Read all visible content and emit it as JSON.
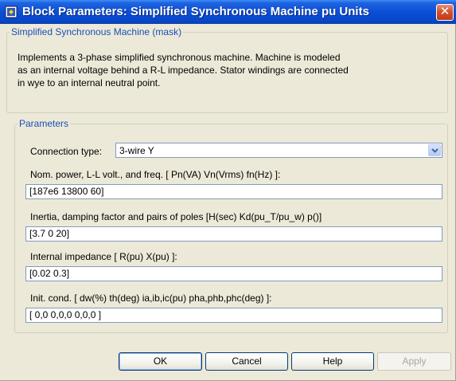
{
  "window": {
    "title": "Block Parameters: Simplified Synchronous Machine pu Units",
    "close_glyph": "✕"
  },
  "mask": {
    "legend": "Simplified Synchronous Machine (mask)",
    "description_lines": [
      "Implements a 3-phase simplified synchronous machine. Machine is modeled",
      "as an internal voltage behind a R-L impedance. Stator windings are connected",
      "in wye to an internal neutral point."
    ]
  },
  "parameters": {
    "legend": "Parameters",
    "connection_type": {
      "label": "Connection type:",
      "value": "3-wire Y"
    },
    "nominal": {
      "label": "Nom. power, L-L volt., and freq. [ Pn(VA) Vn(Vrms) fn(Hz) ]:",
      "value": "[187e6 13800 60]"
    },
    "inertia": {
      "label": "Inertia, damping factor and pairs of poles [H(sec) Kd(pu_T/pu_w) p()]",
      "value": "[3.7 0 20]"
    },
    "impedance": {
      "label": "Internal impedance [ R(pu) X(pu) ]:",
      "value": "[0.02  0.3]"
    },
    "init_cond": {
      "label": "Init. cond. [ dw(%)  th(deg)  ia,ib,ic(pu)  pha,phb,phc(deg) ]:",
      "value": "[ 0,0  0,0,0  0,0,0 ]"
    }
  },
  "buttons": {
    "ok": "OK",
    "cancel": "Cancel",
    "help": "Help",
    "apply": "Apply"
  },
  "icons": {
    "app": "simulink-block-icon",
    "close": "close-icon",
    "dropdown": "chevron-down-icon"
  },
  "colors": {
    "titlebar": "#0a4fd6",
    "dialog_bg": "#ece9d8",
    "legend_text": "#1c4fb8",
    "close_button": "#c13b16",
    "field_border": "#7f9db9"
  }
}
